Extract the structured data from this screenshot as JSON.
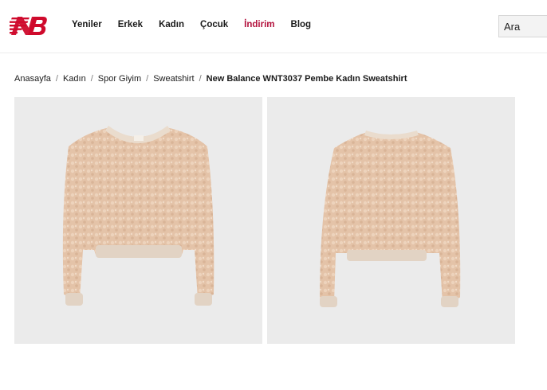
{
  "header": {
    "logo_icon": "new-balance-logo",
    "brand_color": "#cf0a2c",
    "nav": [
      {
        "label": "Yeniler"
      },
      {
        "label": "Erkek"
      },
      {
        "label": "Kadın"
      },
      {
        "label": "Çocuk"
      },
      {
        "label": "İndirim",
        "color": "#b3123d"
      },
      {
        "label": "Blog"
      }
    ],
    "search": {
      "placeholder": "Ara"
    }
  },
  "breadcrumb": {
    "items": [
      "Anasayfa",
      "Kadın",
      "Spor Giyim",
      "Sweatshirt"
    ],
    "separator": "/",
    "current": "New Balance WNT3037 Pembe Kadın Sweatshirt"
  },
  "gallery": {
    "images": [
      {
        "alt": "front view",
        "icon": "sweatshirt-front-image"
      },
      {
        "alt": "back view",
        "icon": "sweatshirt-back-image"
      }
    ],
    "background": "#ebebeb",
    "garment_color": "#e7c8ae"
  }
}
